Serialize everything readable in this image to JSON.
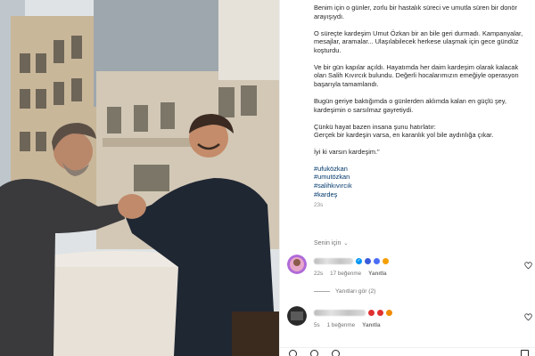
{
  "post": {
    "caption": [
      "Benim için o günler, zorlu bir hastalık süreci ve umutla süren bir donör arayışıydı.",
      "O süreçte kardeşim Umut Özkan bir an bile geri durmadı. Kampanyalar, mesajlar, aramalar... Ulaşılabilecek herkese ulaşmak için gece gündüz koşturdu.",
      "Ve bir gün kapılar açıldı. Hayatımda her daim kardeşim olarak kalacak olan Salih Kıvırcık bulundu. Değerli hocalarımızın emeğiyle operasyon başarıyla tamamlandı.",
      "Bugün geriye baktığımda o günlerden aklımda kalan en güçlü şey, kardeşimin o sarsılmaz gayretiydi."
    ],
    "caption_last_a": "Çünkü hayat bazen insana şunu hatırlatır:",
    "caption_last_b": "Gerçek bir kardeşin varsa, en karanlık yol bile aydınlığa çıkar.",
    "caption_closing": "İyi ki varsın kardeşim.\"",
    "hashtags": [
      "#ufuközkan",
      "#umutözkan",
      "#salihkıvırcık",
      "#kardeş"
    ],
    "time_ago": "23s"
  },
  "comments_sort": {
    "label": "Senin için",
    "chevron_icon": "chevron-down-icon"
  },
  "comments": [
    {
      "time": "22s",
      "likes": "17 beğenme",
      "reply_label": "Yanıtla",
      "avatar_color": "#b06ad8"
    },
    {
      "time": "5s",
      "likes": "1 beğenme",
      "reply_label": "Yanıtla",
      "avatar_color": "#2a2a2a"
    }
  ],
  "replies_toggle": "Yanıtları gör (2)",
  "colors": {
    "hashtag": "#00376b",
    "muted": "#737373",
    "text": "#262626"
  }
}
